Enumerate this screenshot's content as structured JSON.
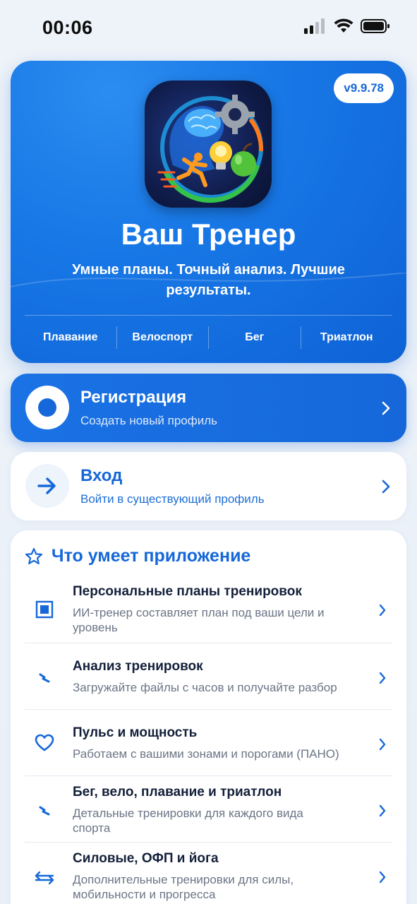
{
  "status_bar": {
    "time": "00:06"
  },
  "hero": {
    "version": "v9.9.78",
    "title": "Ваш Тренер",
    "subtitle": "Умные планы. Точный анализ. Лучшие результаты.",
    "sports": [
      "Плавание",
      "Велоспорт",
      "Бег",
      "Триатлон"
    ]
  },
  "registration": {
    "title": "Регистрация",
    "subtitle": "Создать новый профиль"
  },
  "login": {
    "title": "Вход",
    "subtitle": "Войти в существующий профиль"
  },
  "features": {
    "title": "Что умеет приложение",
    "items": [
      {
        "title": "Персональные планы тренировок",
        "desc": "ИИ-тренер составляет план под ваши цели и уровень",
        "icon": "square-icon"
      },
      {
        "title": "Анализ тренировок",
        "desc": "Загружайте файлы с часов и получайте разбор",
        "icon": "bolt-icon"
      },
      {
        "title": "Пульс и мощность",
        "desc": "Работаем с вашими зонами и порогами (ПАНО)",
        "icon": "heart-icon"
      },
      {
        "title": "Бег, вело, плавание и триатлон",
        "desc": "Детальные тренировки для каждого вида спорта",
        "icon": "bolt-icon"
      },
      {
        "title": "Силовые, ОФП и йога",
        "desc": "Дополнительные тренировки для силы, мобильности и прогресса",
        "icon": "arrows-icon"
      }
    ]
  },
  "colors": {
    "accent": "#1668d8",
    "hero_bg": "#1878e6"
  }
}
